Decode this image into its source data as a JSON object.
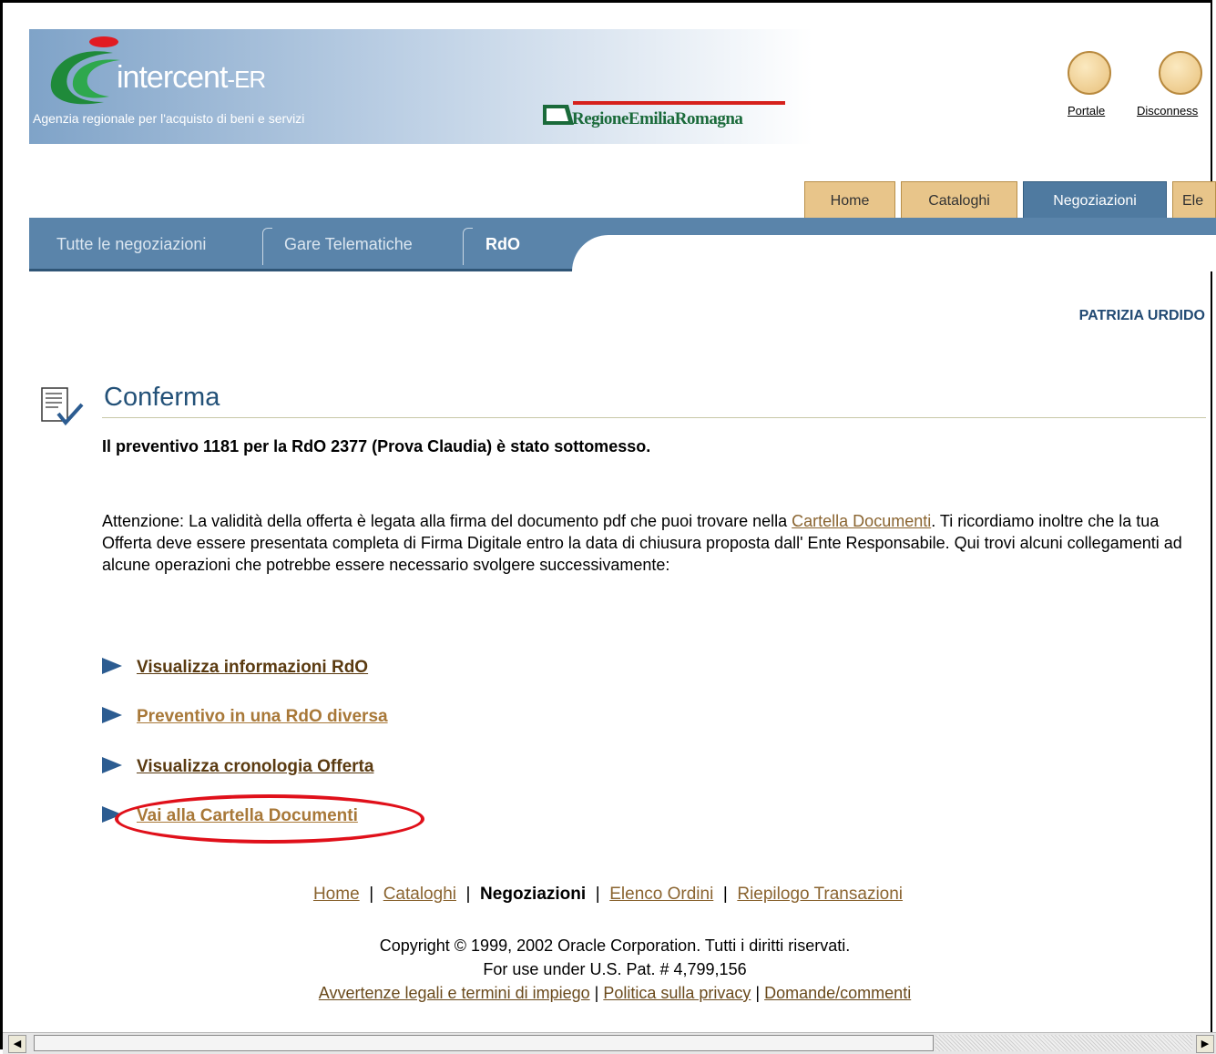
{
  "header": {
    "logo_main": "intercent",
    "logo_suffix": "-ER",
    "agency": "Agenzia regionale per l'acquisto di beni e servizi",
    "region": "RegioneEmiliaRomagna",
    "portal_link": "Portale",
    "disconnect_link": "Disconness"
  },
  "tabs": [
    {
      "label": "Home"
    },
    {
      "label": "Cataloghi"
    },
    {
      "label": "Negoziazioni"
    },
    {
      "label": "Ele"
    }
  ],
  "subnav": [
    {
      "label": "Tutte le negoziazioni"
    },
    {
      "label": "Gare Telematiche"
    },
    {
      "label": "RdO"
    }
  ],
  "user": "PATRIZIA URDIDO",
  "page": {
    "title": "Conferma",
    "message": "Il preventivo 1181 per la RdO 2377 (Prova Claudia) è stato sottomesso.",
    "para_before": "Attenzione: La validità della offerta è legata alla firma del documento pdf che puoi trovare nella ",
    "para_link": "Cartella Documenti",
    "para_after": ". Ti ricordiamo inoltre che la tua Offerta deve essere presentata completa di Firma Digitale entro la data di chiusura proposta dall' Ente Responsabile. Qui trovi alcuni collegamenti ad alcune operazioni che potrebbe essere necessario svolgere successivamente:"
  },
  "actions": [
    {
      "label": "Visualizza informazioni RdO"
    },
    {
      "label": "Preventivo in una RdO diversa"
    },
    {
      "label": "Visualizza cronologia Offerta"
    },
    {
      "label": "Vai alla Cartella Documenti"
    }
  ],
  "footer": {
    "nav": [
      "Home",
      "Cataloghi",
      "Negoziazioni",
      "Elenco Ordini",
      "Riepilogo Transazioni"
    ],
    "separator": "|",
    "copyright": "Copyright © 1999, 2002 Oracle Corporation. Tutti i diritti riservati.",
    "patent": "For use under U.S. Pat. # 4,799,156",
    "legal": "Avvertenze legali e termini di impiego",
    "privacy": "Politica sulla privacy",
    "questions": "Domande/commenti"
  },
  "colors": {
    "highlight": "#e0101a",
    "tab_gold": "#e8c58a",
    "tab_active": "#4f7aa0",
    "title": "#235178"
  }
}
